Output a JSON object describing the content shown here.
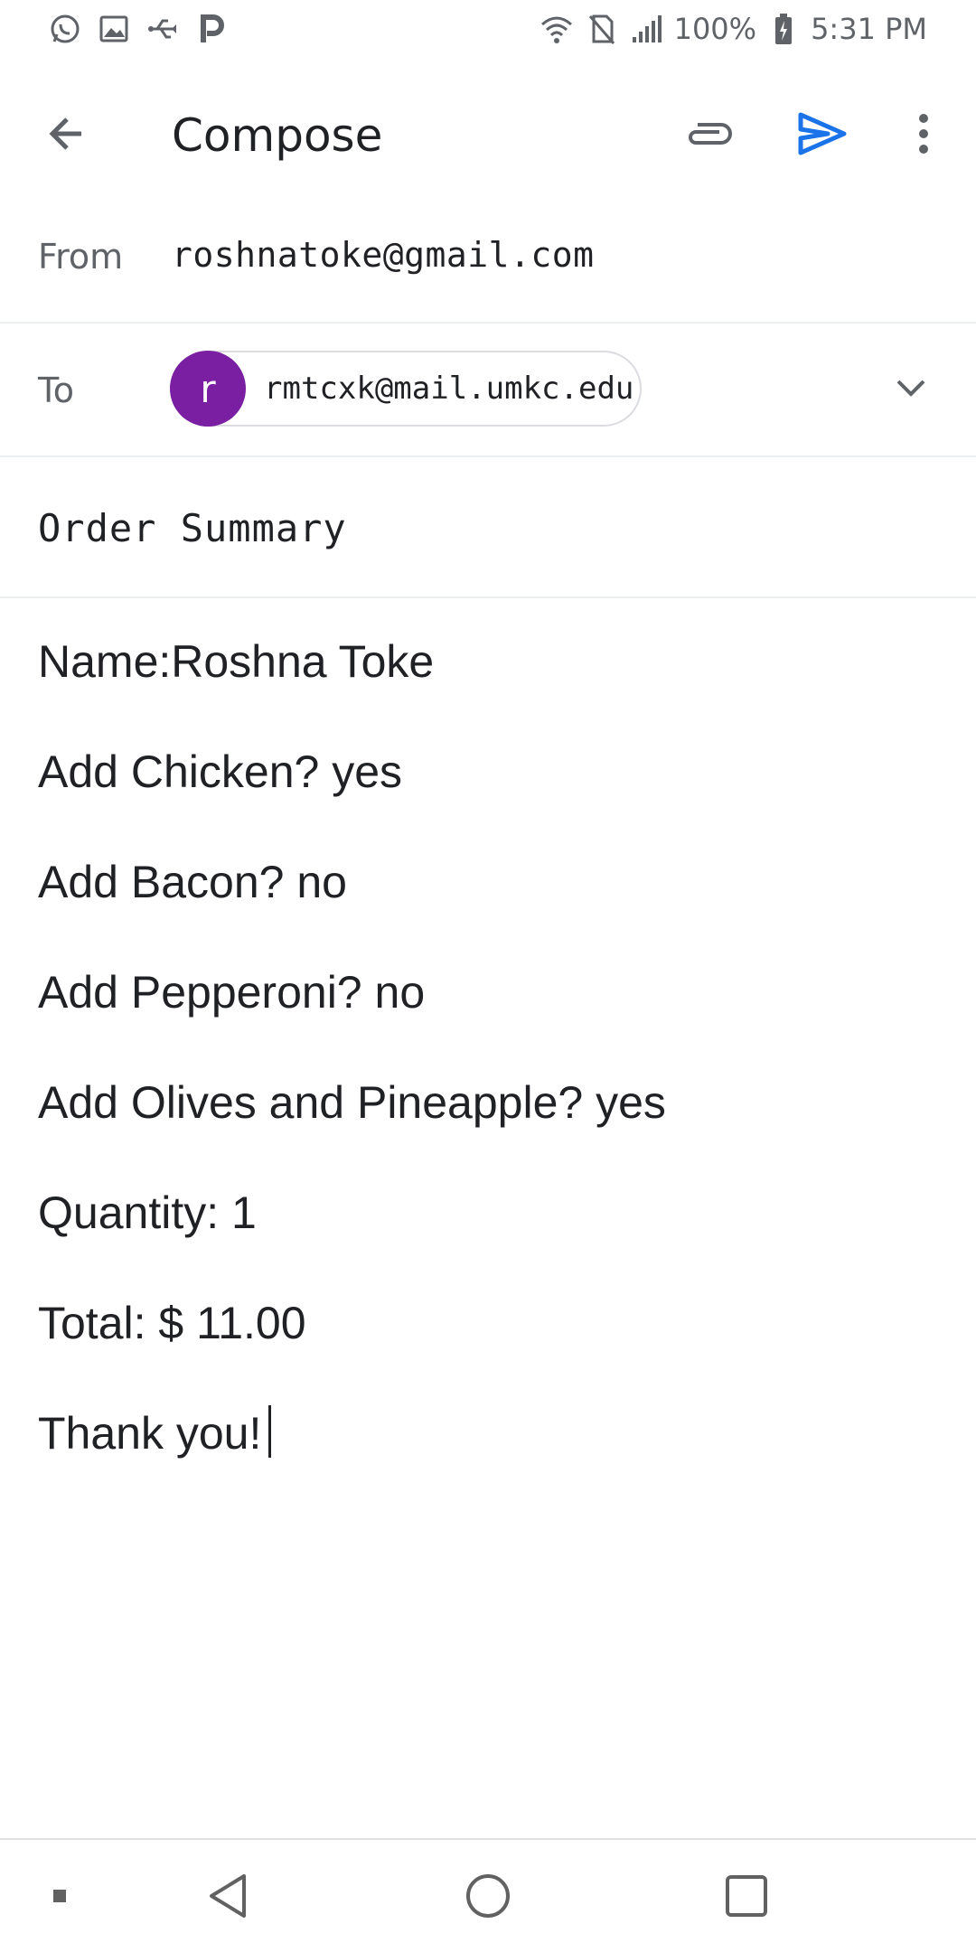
{
  "status_bar": {
    "left_icons": [
      "whatsapp-icon",
      "image-icon",
      "usb-icon",
      "p-app-icon"
    ],
    "battery": "100%",
    "time": "5:31 PM"
  },
  "app_bar": {
    "title": "Compose",
    "actions": [
      "back-arrow-icon",
      "attach-icon",
      "send-icon",
      "more-vert-icon"
    ],
    "send_color": "#1a73e8"
  },
  "from": {
    "label": "From",
    "value": "roshnatoke@gmail.com"
  },
  "to": {
    "label": "To",
    "recipient": {
      "initial": "r",
      "email": "rmtcxk@mail.umkc.edu",
      "avatar_color": "#7b1fa2"
    }
  },
  "subject": {
    "value": "Order Summary"
  },
  "body": {
    "lines": [
      "Name:Roshna Toke",
      "Add Chicken? yes",
      "Add Bacon? no",
      "Add Pepperoni? no",
      "Add Olives and Pineapple? yes",
      "Quantity: 1",
      "Total: $ 11.00",
      "Thank you!"
    ]
  },
  "nav_bar": {
    "items": [
      "small-square-icon",
      "back-triangle-icon",
      "home-circle-icon",
      "recents-square-icon"
    ]
  }
}
